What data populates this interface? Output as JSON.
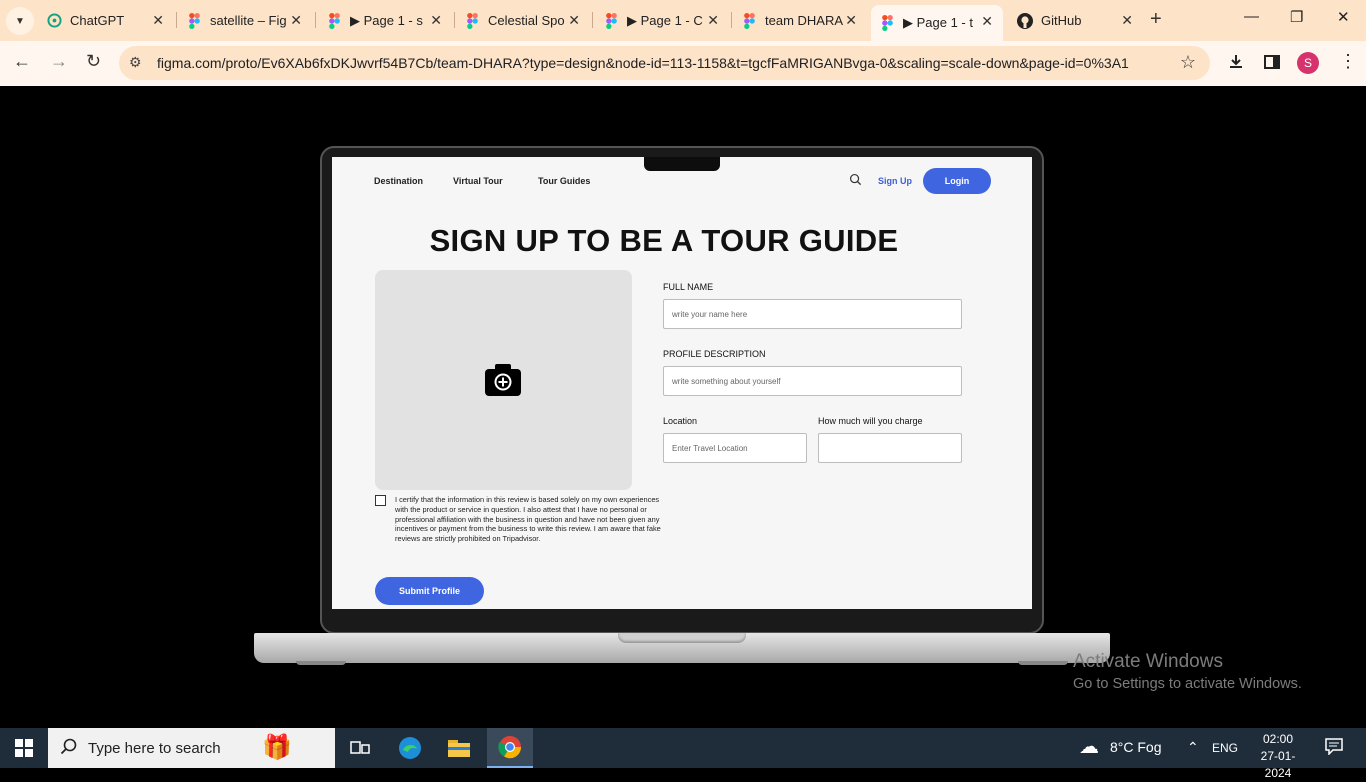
{
  "browser": {
    "tabs": [
      {
        "title": "ChatGPT",
        "icon": "chatgpt-icon"
      },
      {
        "title": "satellite – Fig",
        "icon": "figma-icon"
      },
      {
        "title": "▶ Page 1 - s",
        "icon": "figma-icon"
      },
      {
        "title": "Celestial Spo",
        "icon": "figma-icon"
      },
      {
        "title": "▶ Page 1 - C",
        "icon": "figma-icon"
      },
      {
        "title": "team DHARA",
        "icon": "figma-icon"
      },
      {
        "title": "▶ Page 1 - t",
        "icon": "figma-icon",
        "active": true
      },
      {
        "title": "GitHub",
        "icon": "github-icon"
      }
    ],
    "url": "figma.com/proto/Ev6XAb6fxDKJwvrf54B7Cb/team-DHARA?type=design&node-id=113-1158&t=tgcfFaMRIGANBvga-0&scaling=scale-down&page-id=0%3A1",
    "profile_initial": "S",
    "colors": {
      "tabbar": "#fde3c8",
      "toolbar": "#fff7ef",
      "accent": "#3f66e0"
    }
  },
  "site": {
    "nav": [
      "Destination",
      "Virtual  Tour",
      "Tour Guides"
    ],
    "signup_label": "Sign Up",
    "login_label": "Login",
    "title": "SIGN UP TO BE A TOUR GUIDE",
    "form": {
      "full_name_label": "FULL NAME",
      "full_name_placeholder": "write your name here",
      "description_label": "PROFILE DESCRIPTION",
      "description_placeholder": "write something about yourself",
      "location_label": "Location",
      "location_placeholder": "Enter Travel Location",
      "charge_label": "How much will you charge",
      "charge_placeholder": ""
    },
    "certify_text": "I certify that the information in this review is based solely on my own experiences with the product or service in question. I also attest that I have no personal or professional affiliation with the business in question and have not been given any incentives or payment from the business to write this review. I am aware that fake reviews are strictly prohibited on Tripadvisor.",
    "submit_label": "Submit Profile"
  },
  "watermark": {
    "title": "Activate Windows",
    "subtitle": "Go to Settings to activate Windows."
  },
  "taskbar": {
    "search_placeholder": "Type here to search",
    "weather": "8°C  Fog",
    "language": "ENG",
    "time": "02:00",
    "date": "27-01-2024"
  }
}
